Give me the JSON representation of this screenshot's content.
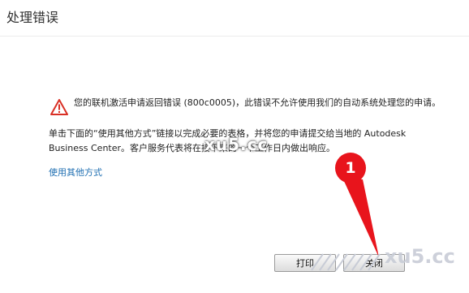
{
  "dialog": {
    "title": "处理错误",
    "message_line1": "您的联机激活申请返回错误 (800c0005)，此错误不允许使用我们的自动系统处理您的申请。",
    "message_line2": "单击下面的“使用其他方式”链接以完成必要的表格，并将您的申请提交给当地的 Autodesk Business Center。客户服务代表将在接下来的一个工作日内做出响应。",
    "alt_link": "使用其他方式",
    "icon": "warning-triangle-icon",
    "accent_color": "#1f6fb2",
    "warning_color": "#d93025"
  },
  "buttons": {
    "print_label": "打印",
    "close_label": "关闭"
  },
  "annotation": {
    "step_number": "1",
    "color": "#e8141c"
  },
  "watermark": {
    "mid_text": "xu5.cc",
    "corner_text": "xu5.cc"
  }
}
